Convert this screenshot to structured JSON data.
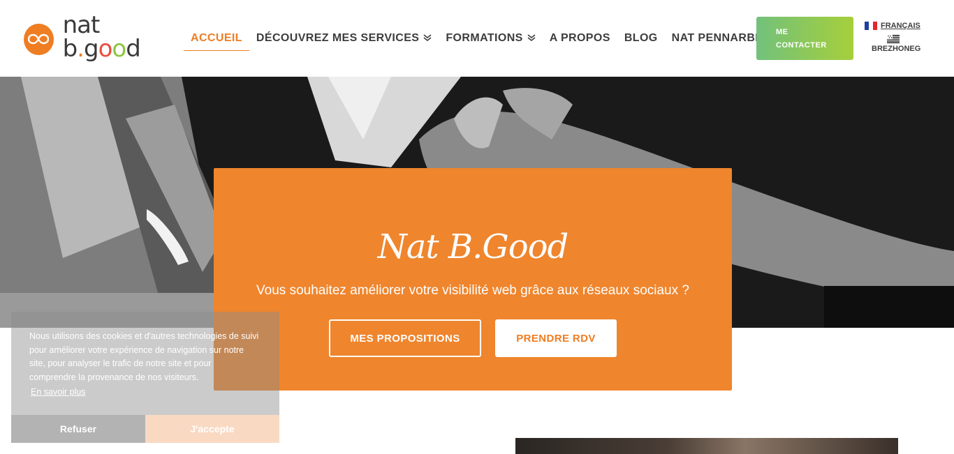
{
  "header": {
    "logo_text": "nat b.good",
    "nav": [
      {
        "label": "ACCUEIL",
        "active": true
      },
      {
        "label": "DÉCOUVREZ MES SERVICES",
        "dropdown": true
      },
      {
        "label": "FORMATIONS",
        "dropdown": true
      },
      {
        "label": "A PROPOS"
      },
      {
        "label": "BLOG"
      },
      {
        "label": "NAT PENNARBED"
      }
    ],
    "contact_label_1": "ME",
    "contact_label_2": "CONTACTER",
    "languages": [
      {
        "label": "FRANÇAIS",
        "flag": "france-flag-icon"
      },
      {
        "label": "BREZHONEG",
        "flag": "breton-flag-icon"
      }
    ]
  },
  "hero": {
    "title": "Nat B.Good",
    "subtitle": "Vous souhaitez améliorer votre visibilité web grâce aux réseaux sociaux ?",
    "btn_propositions": "MES PROPOSITIONS",
    "btn_rdv": "PRENDRE RDV"
  },
  "cookie": {
    "text": "Nous utilisons des cookies et d'autres technologies de suivi pour améliorer votre expérience de navigation sur notre site, pour analyser le trafic de notre site et pour comprendre la provenance de nos visiteurs.",
    "link": "En savoir plus",
    "refuse": "Refuser",
    "accept": "J'accepte"
  },
  "colors": {
    "accent": "#ef7d22",
    "card": "#ef852d",
    "contact_gradient_start": "#72c17c",
    "contact_gradient_end": "#a6cf3b"
  }
}
